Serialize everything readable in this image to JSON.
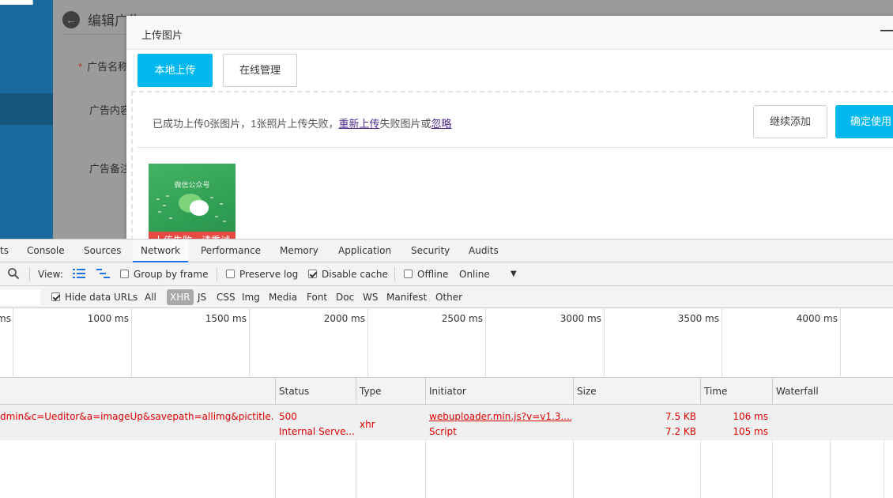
{
  "admin": {
    "page_title": "编辑广告",
    "required_mark": "*",
    "field_ad_name": "广告名称",
    "field_ad_content": "广告内容",
    "field_ad_note": "广告备注"
  },
  "dialog": {
    "title": "上传图片",
    "minimize_glyph": "—",
    "tabs": {
      "local": "本地上传",
      "online": "在线管理"
    },
    "status": {
      "prefix": "已成功上传0张图片，1张照片上传失败，",
      "retry_link": "重新上传",
      "middle": "失败图片或",
      "ignore_link": "忽略"
    },
    "continue_button": "继续添加",
    "confirm_button": "确定使用",
    "thumbnail": {
      "caption": "微信公众号",
      "error_text": "上传失败，请重试"
    }
  },
  "devtools": {
    "tabs": [
      "ts",
      "Console",
      "Sources",
      "Network",
      "Performance",
      "Memory",
      "Application",
      "Security",
      "Audits"
    ],
    "active_tab": "Network",
    "toolbar": {
      "view_label": "View:",
      "group_by_frame": "Group by frame",
      "preserve_log": "Preserve log",
      "disable_cache": "Disable cache",
      "offline": "Offline",
      "throttle_value": "Online",
      "dropdown_glyph": "▼"
    },
    "filter": {
      "hide_data_urls": "Hide data URLs",
      "types": [
        "All",
        "XHR",
        "JS",
        "CSS",
        "Img",
        "Media",
        "Font",
        "Doc",
        "WS",
        "Manifest",
        "Other"
      ],
      "selected_type": "XHR"
    },
    "overview_ticks": [
      "ms",
      "1000 ms",
      "1500 ms",
      "2000 ms",
      "2500 ms",
      "3000 ms",
      "3500 ms",
      "4000 ms"
    ],
    "columns": {
      "status": "Status",
      "type": "Type",
      "initiator": "Initiator",
      "size": "Size",
      "time": "Time",
      "waterfall": "Waterfall"
    },
    "request": {
      "name": "dmin&c=Ueditor&a=imageUp&savepath=allimg&pictitle...",
      "status_code": "500",
      "status_text": "Internal Serve...",
      "type": "xhr",
      "initiator": "webuploader.min.js?v=v1.3....",
      "initiator_type": "Script",
      "size_transferred": "7.5 KB",
      "size_resource": "7.2 KB",
      "time_total": "106 ms",
      "time_latency": "105 ms"
    }
  }
}
